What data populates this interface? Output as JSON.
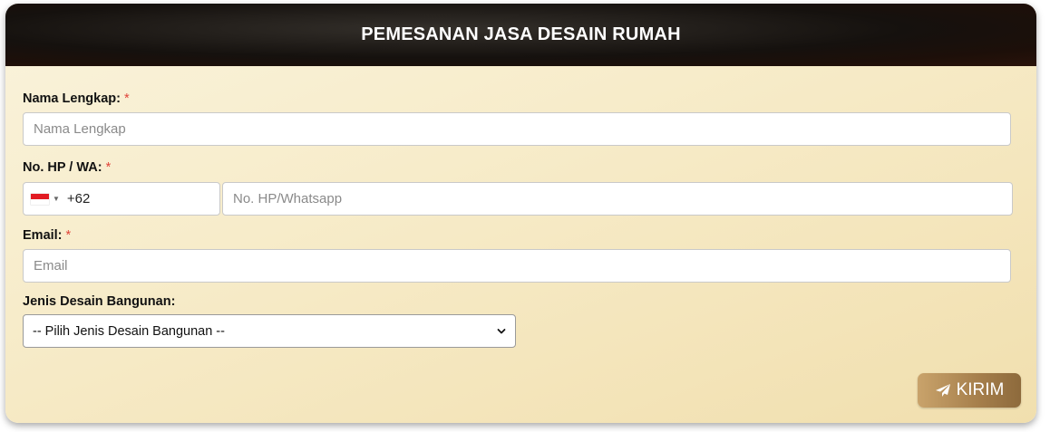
{
  "form": {
    "title": "PEMESANAN JASA DESAIN RUMAH",
    "fields": {
      "name": {
        "label": "Nama Lengkap:",
        "required_mark": "*",
        "placeholder": "Nama Lengkap"
      },
      "phone": {
        "label": "No. HP / WA:",
        "required_mark": "*",
        "country_flag": "indonesia-flag-icon",
        "dial_code": "+62",
        "placeholder": "No. HP/Whatsapp"
      },
      "email": {
        "label": "Email:",
        "required_mark": "*",
        "placeholder": "Email"
      },
      "design_type": {
        "label": "Jenis Desain Bangunan:",
        "selected": "-- Pilih Jenis Desain Bangunan --"
      }
    },
    "submit": {
      "label": "KIRIM",
      "icon": "paper-plane-icon"
    }
  },
  "colors": {
    "header_bg": "#15110e",
    "card_bg": "#f7ecca",
    "required": "#e0443a",
    "button": "#a57e4b",
    "flag_red": "#e21b23"
  }
}
